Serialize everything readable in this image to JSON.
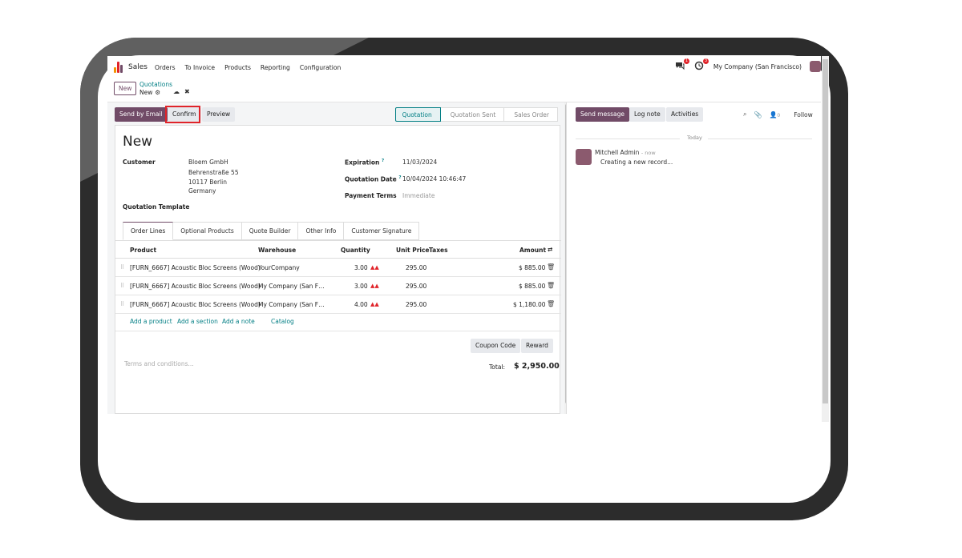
{
  "nav": {
    "app_name": "Sales",
    "menu": [
      "Orders",
      "To Invoice",
      "Products",
      "Reporting",
      "Configuration"
    ],
    "messages_badge": "1",
    "activities_badge": "3",
    "company": "My Company (San Francisco)"
  },
  "breadcrumb": {
    "new_button": "New",
    "parent": "Quotations",
    "current": "New"
  },
  "actions": {
    "send_by_email": "Send by Email",
    "confirm": "Confirm",
    "preview": "Preview"
  },
  "statusbar": {
    "steps": [
      "Quotation",
      "Quotation Sent",
      "Sales Order"
    ],
    "active": "Quotation"
  },
  "form": {
    "title": "New",
    "customer_label": "Customer",
    "customer_lines": [
      "Bloem GmbH",
      "Behrenstraße 55",
      "10117 Berlin",
      "Germany"
    ],
    "expiration_label": "Expiration",
    "expiration_value": "11/03/2024",
    "quotation_date_label": "Quotation Date",
    "quotation_date_value": "10/04/2024 10:46:47",
    "payment_terms_label": "Payment Terms",
    "payment_terms_placeholder": "Immediate",
    "quotation_template_label": "Quotation Template",
    "tooltip_mark": "?"
  },
  "tabs": [
    "Order Lines",
    "Optional Products",
    "Quote Builder",
    "Other Info",
    "Customer Signature"
  ],
  "table": {
    "headers": {
      "product": "Product",
      "warehouse": "Warehouse",
      "quantity": "Quantity",
      "unit_price": "Unit Price",
      "taxes": "Taxes",
      "amount": "Amount"
    },
    "rows": [
      {
        "product": "[FURN_6667] Acoustic Bloc Screens (Wood)",
        "warehouse": "YourCompany",
        "quantity": "3.00",
        "unit_price": "295.00",
        "amount": "$ 885.00"
      },
      {
        "product": "[FURN_6667] Acoustic Bloc Screens (Wood)",
        "warehouse": "My Company (San F…",
        "quantity": "3.00",
        "unit_price": "295.00",
        "amount": "$ 885.00"
      },
      {
        "product": "[FURN_6667] Acoustic Bloc Screens (Wood)",
        "warehouse": "My Company (San F…",
        "quantity": "4.00",
        "unit_price": "295.00",
        "amount": "$ 1,180.00"
      }
    ],
    "add_product": "Add a product",
    "add_section": "Add a section",
    "add_note": "Add a note",
    "catalog": "Catalog"
  },
  "footer": {
    "coupon_code": "Coupon Code",
    "reward": "Reward",
    "terms_placeholder": "Terms and conditions...",
    "total_label": "Total:",
    "total_value": "$ 2,950.00"
  },
  "chatter": {
    "send_message": "Send message",
    "log_note": "Log note",
    "activities": "Activities",
    "follow": "Follow",
    "followers_count": "0",
    "date_separator": "Today",
    "message": {
      "author": "Mitchell Admin",
      "time": "- now",
      "body": "Creating a new record..."
    }
  },
  "colors": {
    "brand": "#714b67",
    "accent": "#017e84",
    "highlight": "#e0242a"
  }
}
